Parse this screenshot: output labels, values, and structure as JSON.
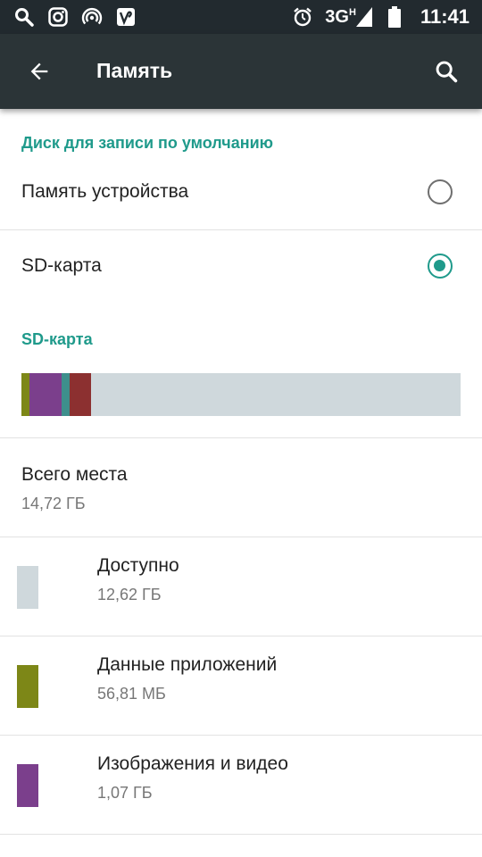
{
  "status_bar": {
    "network": "3G",
    "network_sup": "H",
    "time": "11:41",
    "left_icons": [
      "search-icon",
      "instagram-icon",
      "hotspot-icon",
      "vine-icon"
    ],
    "right_icons": [
      "alarm-icon",
      "signal-icon",
      "battery-icon"
    ]
  },
  "app_bar": {
    "title": "Память",
    "back_icon": "arrow-back-icon",
    "search_icon": "search-icon"
  },
  "default_disk": {
    "header": "Диск для записи по умолчанию",
    "options": [
      {
        "label": "Память устройства",
        "checked": false
      },
      {
        "label": "SD-карта",
        "checked": true
      }
    ]
  },
  "sd_card": {
    "header": "SD-карта",
    "usage_bar": [
      {
        "name": "Данные приложений",
        "fraction": 0.018,
        "color": "#7d8717"
      },
      {
        "name": "Изображения и видео",
        "fraction": 0.073,
        "color": "#7b3f8c"
      },
      {
        "name": "other-teal",
        "fraction": 0.018,
        "color": "#3e8f8c"
      },
      {
        "name": "other-brown",
        "fraction": 0.05,
        "color": "#8c3030"
      },
      {
        "name": "Доступно",
        "fraction": 0.841,
        "color": "#cfd8dc"
      }
    ],
    "total": {
      "label": "Всего места",
      "value": "14,72 ГБ"
    },
    "items": [
      {
        "label": "Доступно",
        "value": "12,62 ГБ",
        "color": "#cfd8dc"
      },
      {
        "label": "Данные приложений",
        "value": "56,81 МБ",
        "color": "#7d8717"
      },
      {
        "label": "Изображения и видео",
        "value": "1,07 ГБ",
        "color": "#7b3f8c"
      }
    ]
  }
}
